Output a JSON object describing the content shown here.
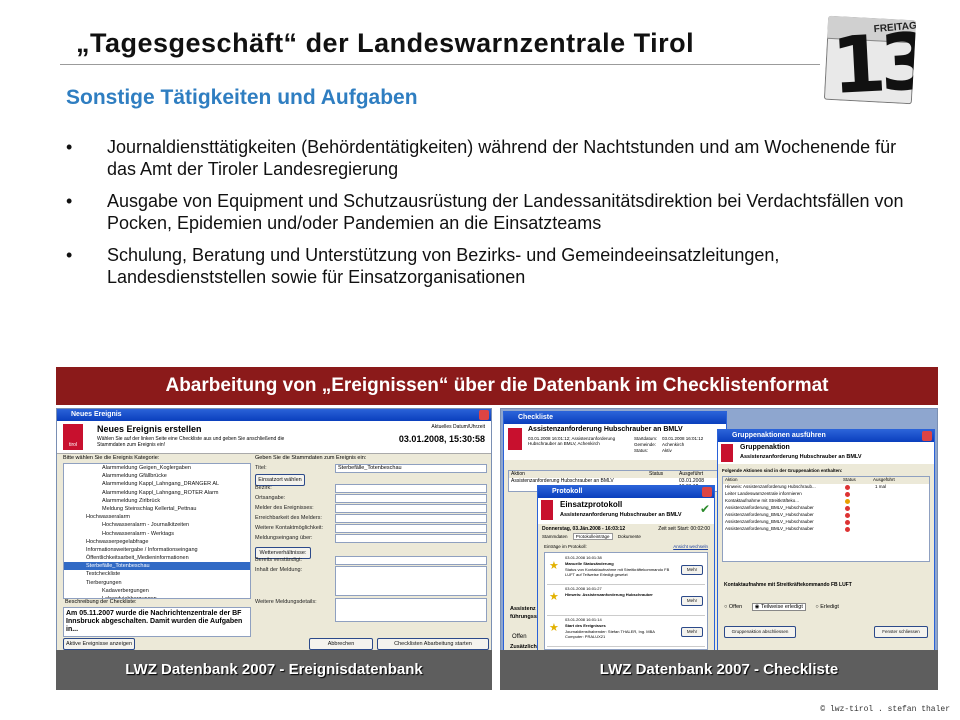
{
  "slide": {
    "title": "„Tagesgeschäft“ der Landeswarnzentrale Tirol",
    "subtitle": "Sonstige Tätigkeiten und Aufgaben",
    "calendar": {
      "day": "FREITAG",
      "number": "13"
    },
    "bullets": [
      "Journaldiensttätigkeiten (Behördentätigkeiten) während der Nachtstunden und am Wochenende für das Amt der Tiroler Landesregierung",
      "Ausgabe von Equipment und Schutzausrüstung der Landessanitätsdirektion bei Verdachtsfällen von Pocken, Epidemien und/oder Pandemien an die Einsatzteams",
      "Schulung, Beratung und Unterstützung von Bezirks- und Gemeindeeinsatzleitungen, Landesdienststellen sowie für Einsatzorganisationen"
    ],
    "bullet_symbol": "•",
    "banner": "Abarbeitung von „Ereignissen“ über die Datenbank im Checklistenformat",
    "captions": {
      "left": "LWZ Datenbank 2007 - Ereignisdatenbank",
      "right": "LWZ Datenbank 2007 - Checkliste"
    },
    "footer": "© lwz-tirol . stefan thaler",
    "colors": {
      "subtitle": "#2f7ec1",
      "banner": "#8b1a1a",
      "caption": "#5e5e5e"
    }
  },
  "left_shot": {
    "window_title": "Neues Ereignis",
    "heading": "Neues Ereignis erstellen",
    "hint": "Wählen Sie auf der linken Seite eine Checkliste aus und geben Sie anschließend die Stammdaten zum Ereignis ein!",
    "date_label": "Aktuelles Datum/Uhrzeit",
    "datetime": "03.01.2008, 15:30:58",
    "logo_text": "tirol",
    "tree_label": "Bitte wählen Sie die Ereignis Kategorie:",
    "tree": [
      "Alarmmeldung Geigen_Koglergaben",
      "Alarmmeldung Gfällbrücke",
      "Alarmmeldung Kappl_Lahngang_DRANGER AL",
      "Alarmmeldung Kappl_Lahngang_ROTER Alarm",
      "Alarmmeldung Zirlbrück",
      "Meldung Steinschlag Kellertal_Pettnau",
      "Hochwasseralarm",
      "Hochwasseralarm - Journalkitzeiten",
      "Hochwasseralarm - Werktags",
      "Hochwasserpegelabfrage",
      "Informationsweitergabe / Informationseingang",
      "Öffentlichkeitsarbeit_Medieninformationen",
      "Sterbefälle_Totenbeschau",
      "Testcheckliste",
      "Tierbergungen",
      "Kadaverbergungen",
      "Lebendviehbergungen",
      "Verkehr - Ausnahmegenehmigungen",
      "Ausnahmegenehmigung Wochenendfahrverbot",
      "Verständigung Landeshauptmann",
      "Wetterwarnung"
    ],
    "form_header": "Geben Sie die Stammdaten zum Ereignis ein:",
    "form_labels": [
      "Titel:",
      "Bezirk:",
      "Ortsangabe:",
      "Melder des Ereignisses:",
      "Erreichbarkeit des Melders:",
      "Weitere Kontaktmöglichkeit:",
      "Meldungseingang über:",
      "Bereits verständigt:",
      "Inhalt der Meldung:",
      "Weitere Meldungsdetails:"
    ],
    "title_value": "Sterbefälle_Totenbeschau",
    "einsatzort_button": "Einsatzort wählen",
    "weiterverhaeltnisse_button": "Wetterverhältnisse:",
    "description_label": "Beschreibung der Checkliste:",
    "description": "Am 05.11.2007 wurde die Nachrichtenzentrale der BF Innsbruck abgeschalten. Damit wurden die Aufgaben in...",
    "btn_active": "Aktive Ereignisse anzeigen",
    "btn_cancel": "Abbrechen",
    "btn_start": "Checklisten Abarbeitung starten"
  },
  "right_shot": {
    "window_title": "Checkliste",
    "heading": "Assistenzanforderung Hubschrauber an BMLV",
    "sub": "03.01.2008 16:01:12; Assistenzanforderung Hubschrauber an BMLV, Achenkirch",
    "meta_labels": [
      "Startdatum:",
      "Gemeinde:",
      "Status:"
    ],
    "meta_values": [
      "03.01.2008 16:01:12",
      "Achenkirch",
      "Aktiv"
    ],
    "action_col": "Aktion",
    "status_col": "Status",
    "date_col": "Ausgeführt",
    "row": "Assistenzanforderung Hubschrauber an BMLV",
    "row_date": "03.01.2008 16:01:12",
    "group_title": "Gruppenaktionen ausführen",
    "group_heading": "Gruppenaktion",
    "group_sub": "Assistenzanforderung Hubschrauber an BMLV",
    "group_instructions": "Folgende Aktionen sind in der Gruppenaktion enthalten:",
    "group_rows": [
      "Hinweis: Assistenzanforderung Hubschraub...",
      "Leiter Landeswarnzentrale informieren",
      "Kontaktaufnahme mit Streitkräfteko...",
      "Assistenzanforderung_BMLV_Hubschrauber",
      "Assistenzanforderung_BMLV_Hubschrauber",
      "Assistenzanforderung_BMLV_Hubschrauber",
      "Assistenzanforderung_BMLV_Hubschrauber"
    ],
    "group_row_note": "1 mal",
    "group_contact": "Kontaktaufnahme mit Streitkräftekommando FB LUFT",
    "radio_options": [
      "Offen",
      "Teilweise erledigt",
      "Erledigt"
    ],
    "btn_close": "Gruppenaktion abschliessen",
    "btn_window": "Fenster schliessen",
    "protocol_window": "Protokoll",
    "protocol_heading": "Einsatzprotokoll",
    "protocol_sub": "Assistenzanforderung Hubschrauber an BMLV",
    "protocol_date": "Donnerstag, 03.Jän.2008 - 16:03:12",
    "protocol_elapsed": "Zeit seit Start: 00:02:00",
    "protocol_tabs": [
      "Stammdaten",
      "Protokolleinträge",
      "Dokumente"
    ],
    "protocol_entries_label": "Einträge im Protokoll:",
    "protocol_view": "Ansicht wechseln",
    "entries": [
      {
        "time": "03.01.2008 16:01:38",
        "title": "Manuelle Statusänderung",
        "text": "Status von Kontaktaufnahme mit Streitkräftekommando FB LUFT auf Teilweise Erledigt gesetzt"
      },
      {
        "time": "03.01.2008 16:01:27",
        "title": "Hinweis: Assistenzanforderung Hubschrauber",
        "text": ""
      },
      {
        "time": "03.01.2008 16:01:14",
        "title": "Start des Ereignisses",
        "text": "Journaldiensthabender: Stefan THALER, Ing. MBA Computer: PRALUX21"
      }
    ],
    "more_button": "Mehr",
    "side_label": "Assistenz",
    "side_label2": "führungsst",
    "side_radio": "Offen",
    "side_label3": "Zusätzlich"
  }
}
